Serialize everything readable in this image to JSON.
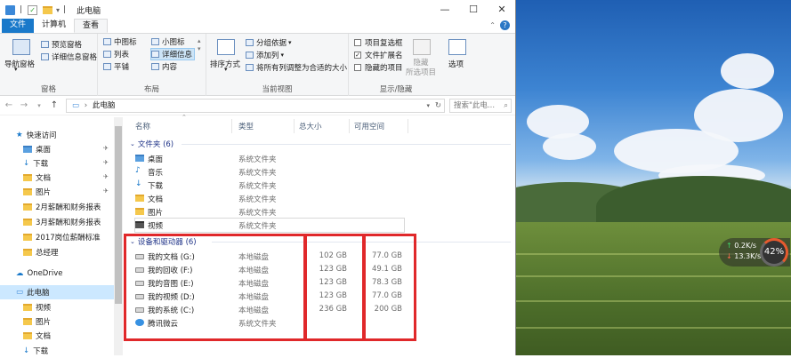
{
  "window": {
    "title": "此电脑",
    "controls": {
      "minimize": "—",
      "maximize": "☐",
      "close": "✕"
    }
  },
  "tabs": [
    {
      "label": "文件"
    },
    {
      "label": "计算机"
    },
    {
      "label": "查看"
    }
  ],
  "ribbon": {
    "pane_group": {
      "nav_pane": "导航窗格",
      "preview_pane": "预览窗格",
      "details_pane": "详细信息窗格",
      "label": "窗格"
    },
    "layout_group": {
      "items": [
        "中图标",
        "小图标",
        "列表",
        "详细信息",
        "平铺",
        "内容"
      ],
      "label": "布局"
    },
    "current_view_group": {
      "sort_by": "排序方式",
      "group_by": "分组依据",
      "add_column": "添加列",
      "fit_columns": "将所有列调整为合适的大小",
      "label": "当前视图"
    },
    "show_hide_group": {
      "item_checkbox": "项目复选框",
      "file_ext": "文件扩展名",
      "hidden_items": "隐藏的项目",
      "hide_selected": "隐藏\n所选项目",
      "options": "选项",
      "label": "显示/隐藏"
    }
  },
  "address": {
    "path": "此电脑",
    "search_placeholder": "搜索\"此电..."
  },
  "nav_pane": {
    "quick_access": "快速访问",
    "items": [
      {
        "label": "桌面",
        "pinned": true
      },
      {
        "label": "下载",
        "pinned": true
      },
      {
        "label": "文档",
        "pinned": true
      },
      {
        "label": "图片",
        "pinned": true
      },
      {
        "label": "2月薪酬和财务报表",
        "pinned": false
      },
      {
        "label": "3月薪酬和财务报表",
        "pinned": false
      },
      {
        "label": "2017岗位薪酬标准",
        "pinned": false
      },
      {
        "label": "总经理",
        "pinned": false
      }
    ],
    "onedrive": "OneDrive",
    "this_pc": "此电脑",
    "pc_items": [
      "视频",
      "图片",
      "文档",
      "下载"
    ],
    "pin_glyph": "✈"
  },
  "columns": {
    "name": "名称",
    "type": "类型",
    "total": "总大小",
    "free": "可用空间"
  },
  "folders_group": "文件夹 (6)",
  "folders": [
    {
      "name": "桌面",
      "type": "系统文件夹"
    },
    {
      "name": "音乐",
      "type": "系统文件夹"
    },
    {
      "name": "下载",
      "type": "系统文件夹"
    },
    {
      "name": "文档",
      "type": "系统文件夹"
    },
    {
      "name": "图片",
      "type": "系统文件夹"
    },
    {
      "name": "视频",
      "type": "系统文件夹"
    }
  ],
  "devices_group": "设备和驱动器 (6)",
  "drives": [
    {
      "name": "我的文档 (G:)",
      "type": "本地磁盘",
      "total": "102 GB",
      "free": "77.0 GB"
    },
    {
      "name": "我的回收 (F:)",
      "type": "本地磁盘",
      "total": "123 GB",
      "free": "49.1 GB"
    },
    {
      "name": "我的音图 (E:)",
      "type": "本地磁盘",
      "total": "123 GB",
      "free": "78.3 GB"
    },
    {
      "name": "我的视频 (D:)",
      "type": "本地磁盘",
      "total": "123 GB",
      "free": "77.0 GB"
    },
    {
      "name": "我的系统 (C:)",
      "type": "本地磁盘",
      "total": "236 GB",
      "free": "200 GB"
    },
    {
      "name": "腾讯微云",
      "type": "系统文件夹",
      "total": "",
      "free": ""
    }
  ],
  "net_widget": {
    "up": "0.2K/s",
    "down": "13.3K/s",
    "percent": "42%"
  },
  "colors": {
    "highlight_box": "#e0282a",
    "file_tab": "#1979ca",
    "group_header": "#1e3287"
  }
}
